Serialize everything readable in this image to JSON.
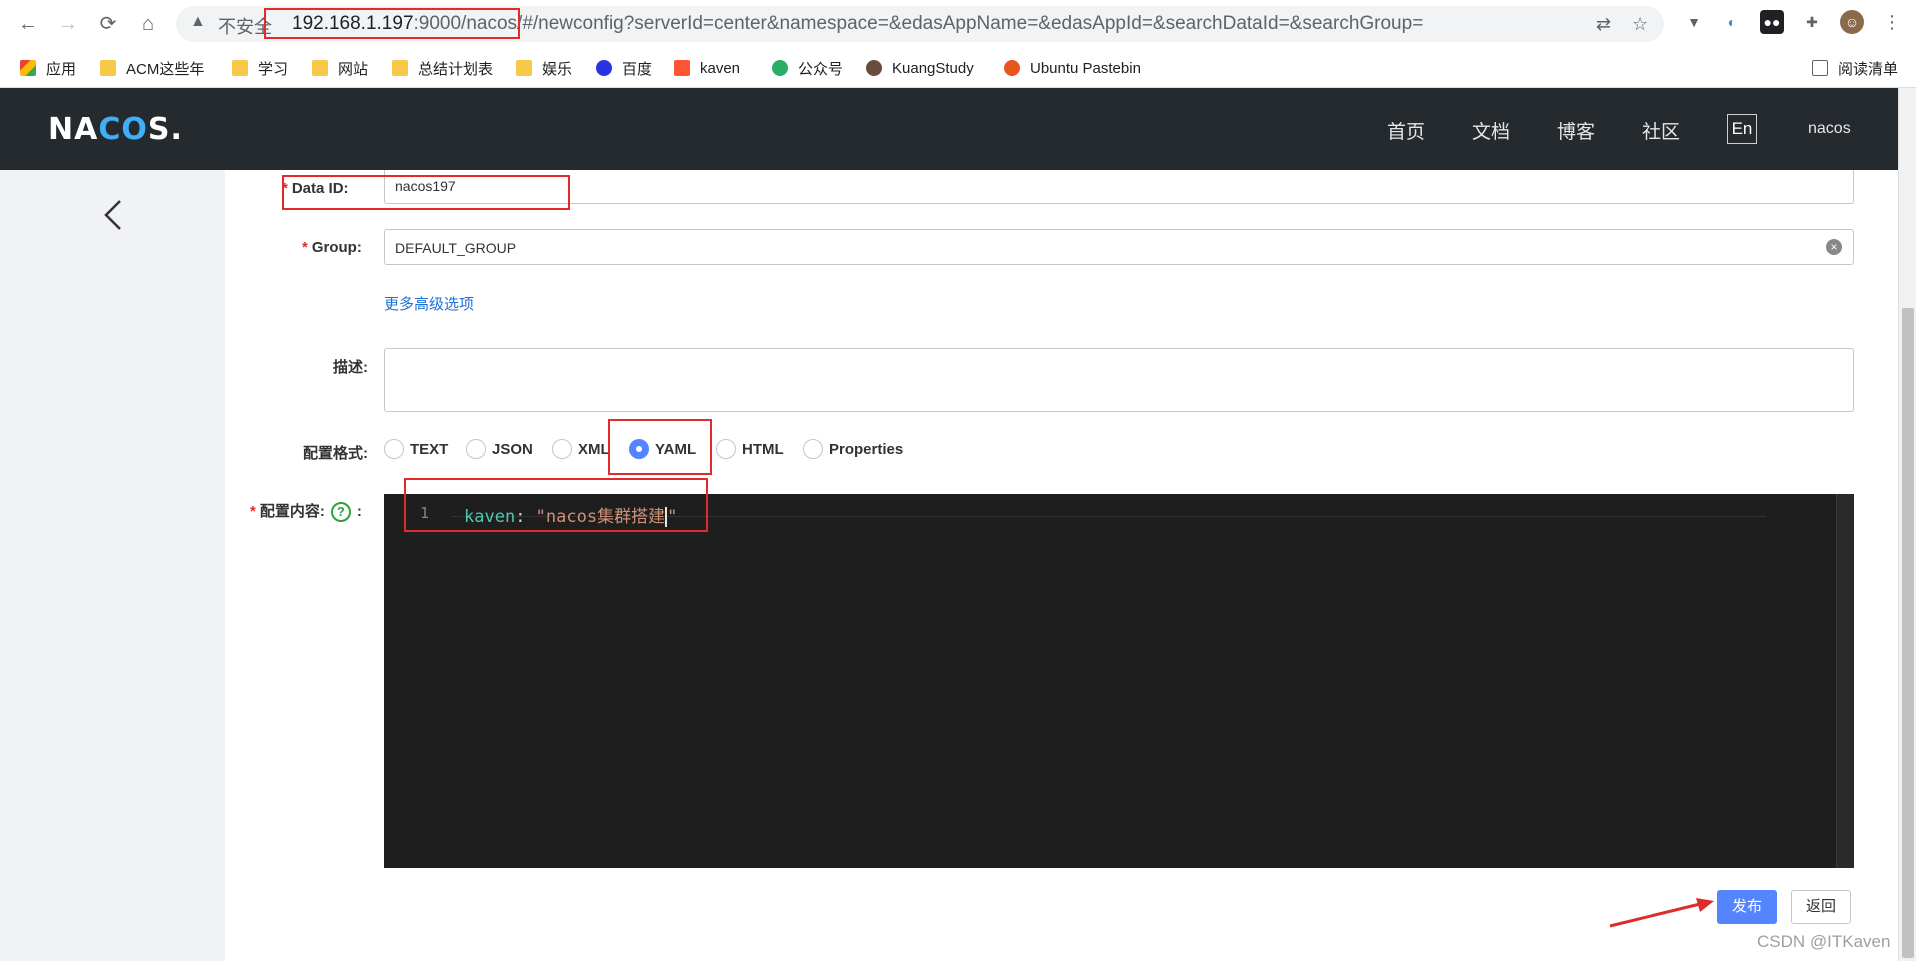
{
  "browser": {
    "insecure_label": "不安全",
    "url_host": "192.168.1.197",
    "url_port_path": ":9000/nacos/",
    "url_rest": "#/newconfig?serverId=center&namespace=&edasAppName=&edasAppId=&searchDataId=&searchGroup=",
    "bookmarks": [
      "应用",
      "ACM这些年",
      "学习",
      "网站",
      "总结计划表",
      "娱乐",
      "百度",
      "kaven",
      "公众号",
      "KuangStudy",
      "Ubuntu Pastebin"
    ],
    "reading_list": "阅读清单"
  },
  "header": {
    "logo_pre": "NA",
    "logo_mid": "CO",
    "logo_post": "S.",
    "nav": [
      "首页",
      "文档",
      "博客",
      "社区"
    ],
    "lang": "En",
    "user": "nacos"
  },
  "form": {
    "data_id_label": "Data ID:",
    "data_id_value": "nacos197",
    "group_label": "Group:",
    "group_value": "DEFAULT_GROUP",
    "advanced_link": "更多高级选项",
    "desc_label": "描述:",
    "format_label": "配置格式:",
    "formats": [
      "TEXT",
      "JSON",
      "XML",
      "YAML",
      "HTML",
      "Properties"
    ],
    "selected_format": "YAML",
    "content_label": "配置内容:",
    "content_colon": ":",
    "help_icon": "?",
    "editor": {
      "line_no": "1",
      "key": "kaven",
      "sep": ": ",
      "value_open": "\"nacos集群搭建",
      "value_close": "\""
    },
    "publish_button": "发布",
    "back_button": "返回"
  },
  "watermark": "CSDN @ITKaven",
  "colors": {
    "accent": "#5584ff",
    "header_bg": "#252a2f",
    "highlight": "#e02b2b"
  }
}
